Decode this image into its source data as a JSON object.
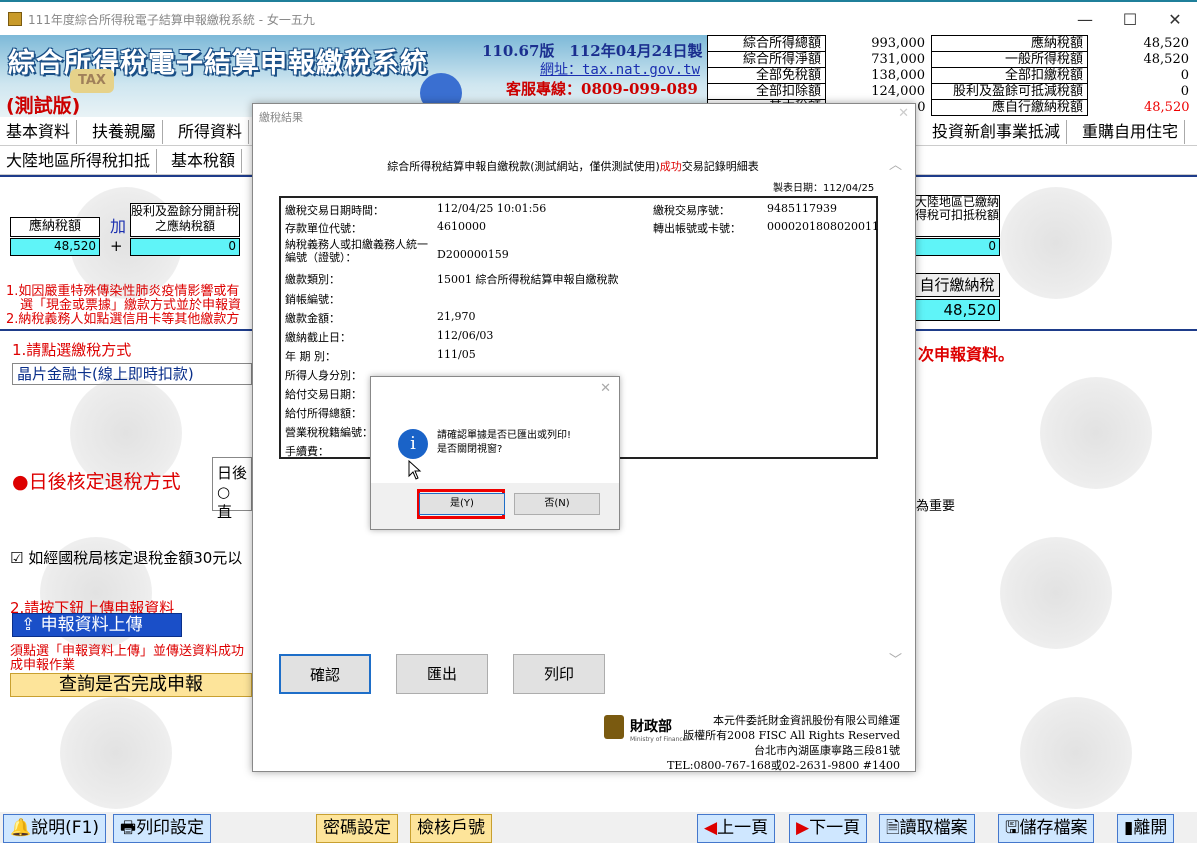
{
  "window": {
    "title": "111年度綜合所得稅電子結算申報繳稅系統 - 女一五九",
    "min": "—",
    "max": "☐",
    "close": "✕"
  },
  "banner": {
    "title": "綜合所得稅電子結算申報繳稅系統",
    "test_label": "(測試版)",
    "version": "110.67版　112年04月24日製",
    "url": "網址：tax.nat.gov.tw",
    "hotline": "客服專線：0809-099-089",
    "tax_badge": "TAX"
  },
  "summary_left": [
    {
      "label": "綜合所得總額",
      "value": "993,000"
    },
    {
      "label": "綜合所得淨額",
      "value": "731,000"
    },
    {
      "label": "全部免稅額",
      "value": "138,000"
    },
    {
      "label": "全部扣除額",
      "value": "124,000"
    },
    {
      "label": "基本稅額",
      "value": "0"
    }
  ],
  "summary_right": [
    {
      "label": "應納稅額",
      "value": "48,520"
    },
    {
      "label": "一般所得稅額",
      "value": "48,520"
    },
    {
      "label": "全部扣繳稅額",
      "value": "0"
    },
    {
      "label": "股利及盈餘可抵減稅額",
      "value": "0"
    },
    {
      "label": "應自行繳納稅額",
      "value": "48,520"
    }
  ],
  "tabs_row1": [
    "基本資料",
    "扶養親屬",
    "所得資料",
    "投資新創事業抵減",
    "重購自用住宅"
  ],
  "tabs_row2": [
    "大陸地區所得稅扣抵",
    "基本稅額"
  ],
  "calc": {
    "due_label": "應納稅額",
    "due_value": "48,520",
    "plus_word": "加",
    "plus_sign": "+",
    "div_label": "股利及盈餘分開計稅之應納稅額",
    "div_value": "0",
    "mainland_label": "大陸地區已繳納得稅可扣抵稅額",
    "mainland_value": "0",
    "self_pay_label": "自行繳納稅額",
    "self_pay_value": "48,520"
  },
  "notes": {
    "n1": "1.如因嚴重特殊傳染性肺炎疫情影響或有",
    "n1b": "選「現金或票據」繳款方式並於申報資",
    "n2": "2.納稅義務人如點選信用卡等其他繳款方"
  },
  "step1": {
    "label": "1.請點選繳稅方式",
    "method": "晶片金融卡(線上即時扣款)",
    "right_hint": "次申報資料。"
  },
  "refund": {
    "label": "●日後核定退稅方式",
    "sub": "日後",
    "opt": "○ 直",
    "right": "為重要"
  },
  "check_note": "☑ 如經國稅局核定退稅金額30元以",
  "step2": {
    "label": "2.請按下鈕上傳申報資料",
    "upload_btn": "申報資料上傳",
    "note1": "須點選「申報資料上傳」並傳送資料成功",
    "note2": "成申報作業",
    "query_btn": "查詢是否完成申報"
  },
  "bottom": {
    "help": "說明(F1)",
    "print_setup": "列印設定",
    "password": "密碼設定",
    "verify": "檢核戶號",
    "prev": "上一頁",
    "next": "下一頁",
    "read": "讀取檔案",
    "save": "儲存檔案",
    "exit": "離開"
  },
  "dialog": {
    "title": "繳稅結果",
    "close": "✕",
    "heading_pre": "綜合所得稅結算申報自繳稅款(測試網站，僅供測試使用)",
    "heading_ok": "成功",
    "heading_post": "交易記錄明細表",
    "print_date": "製表日期：112/04/25",
    "rows_left": [
      {
        "label": "繳稅交易日期時間：",
        "value": "112/04/25 10:01:56"
      },
      {
        "label": "存款單位代號：",
        "value": "4610000"
      },
      {
        "label": "納稅義務人或扣繳義務人統一編號（證號）：",
        "value": "D200000159"
      },
      {
        "label": "繳款類別：",
        "value": "15001 綜合所得稅結算申報自繳稅款"
      },
      {
        "label": "銷帳編號：",
        "value": ""
      },
      {
        "label": "繳款金額：",
        "value": "21,970"
      },
      {
        "label": "繳納截止日：",
        "value": "112/06/03"
      },
      {
        "label": "年 期 別：",
        "value": "111/05"
      },
      {
        "label": "所得人身分別：",
        "value": ""
      },
      {
        "label": "給付交易日期：",
        "value": ""
      },
      {
        "label": "給付所得總額：",
        "value": ""
      },
      {
        "label": "營業稅稅籍編號：",
        "value": ""
      },
      {
        "label": "手續費：",
        "value": ""
      }
    ],
    "rows_right": [
      {
        "label": "繳稅交易序號：",
        "value": "9485117939"
      },
      {
        "label": "轉出帳號或卡號：",
        "value": "0000201808020011"
      }
    ],
    "buttons": {
      "confirm": "確認",
      "export": "匯出",
      "print": "列印"
    },
    "footer": {
      "ministry": "財政部",
      "ministry_en": "Ministry of Finance",
      "l1": "本元件委託財金資訊股份有限公司維運",
      "l2": "版權所有2008 FISC All Rights Reserved",
      "l3": "台北市內湖區康寧路三段81號",
      "l4": "TEL:0800-767-168或02-2631-9800 #1400"
    }
  },
  "msgbox": {
    "close": "✕",
    "icon": "i",
    "line1": "請確認單據是否已匯出或列印!",
    "line2": "是否關閉視窗?",
    "yes": "是(Y)",
    "no": "否(N)"
  }
}
